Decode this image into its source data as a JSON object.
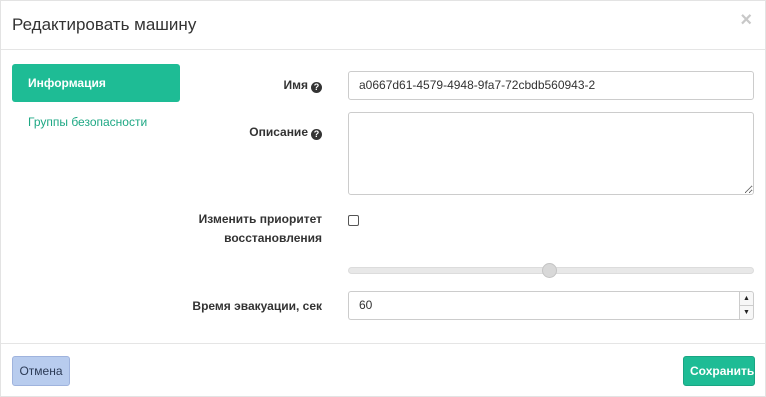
{
  "modal": {
    "title": "Редактировать машину",
    "close_glyph": "×"
  },
  "tabs": [
    {
      "label": "Информация",
      "active": true
    },
    {
      "label": "Группы безопасности",
      "active": false
    }
  ],
  "form": {
    "name_label": "Имя",
    "name_value": "a0667d61-4579-4948-9fa7-72cbdb560943-2",
    "description_label": "Описание",
    "description_value": "",
    "priority_label_line1": "Изменить приоритет",
    "priority_label_line2": "восстановления",
    "priority_checked": false,
    "evac_label": "Время эвакуации, сек",
    "evac_value": "60",
    "help_glyph": "?"
  },
  "footer": {
    "cancel_label": "Отмена",
    "save_label": "Сохранить"
  },
  "colors": {
    "accent": "#1ebc95",
    "cancel_bg": "#b8ccee"
  },
  "icons": [
    "help-icon",
    "close-icon",
    "spin-up-icon",
    "spin-down-icon"
  ]
}
